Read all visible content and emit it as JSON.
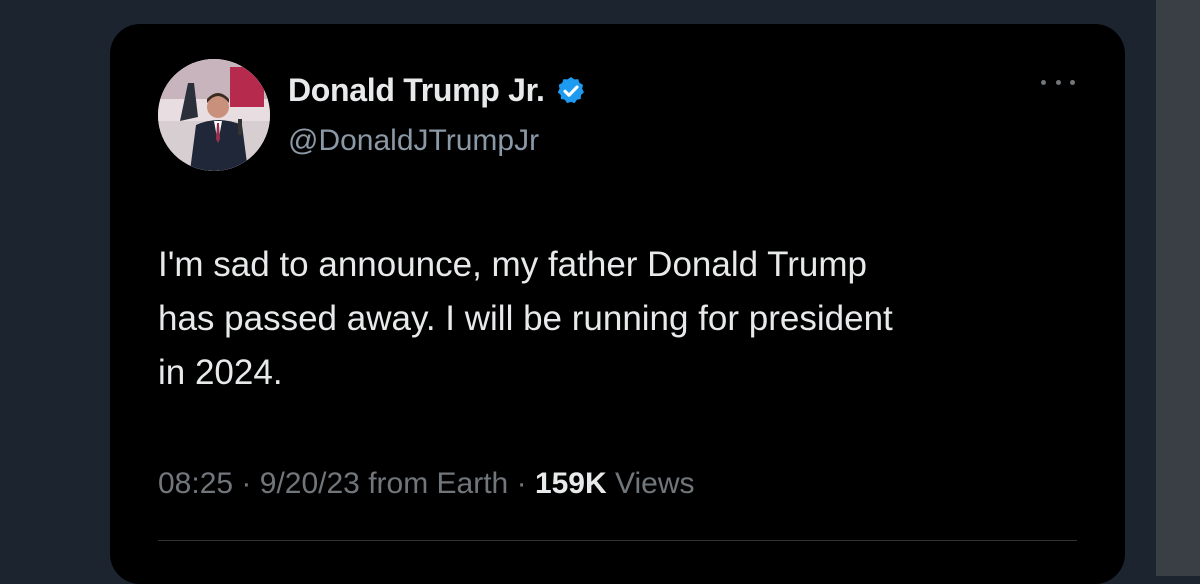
{
  "tweet": {
    "author": {
      "display_name": "Donald Trump Jr.",
      "handle": "@DonaldJTrumpJr",
      "verified": true,
      "avatar_icon": "profile-photo"
    },
    "text_lines": [
      "I'm sad to announce, my father Donald Trump",
      "has passed away. I will be running for president",
      "in 2024."
    ],
    "meta": {
      "time": "08:25",
      "separator": "·",
      "date": "9/20/23",
      "source": "from Earth",
      "views_count": "159K",
      "views_label": "Views"
    },
    "more_icon": "more-horizontal-icon"
  },
  "colors": {
    "background": "#1c2430",
    "card": "#000000",
    "primary_text": "#e7e9ea",
    "secondary_text": "#71767b",
    "verified_blue": "#1d9bf0"
  }
}
